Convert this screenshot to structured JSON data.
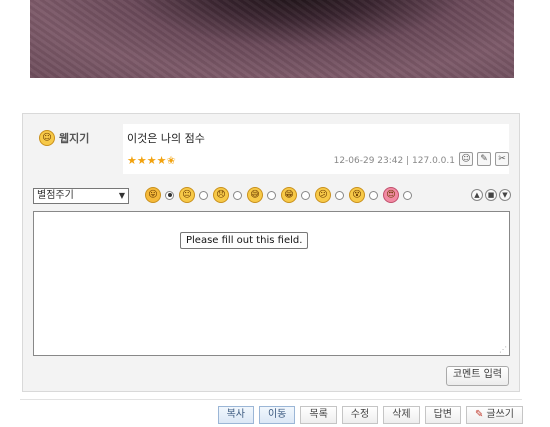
{
  "comment": {
    "author": "웹지기",
    "text": "이것은 나의 점수",
    "rating": 4.5,
    "date": "12-06-29 23:42",
    "ip": "127.0.0.1",
    "separator": "|"
  },
  "toolbar": {
    "score_select": "별점주기",
    "emoticons": [
      "tongue",
      "neutral",
      "sad",
      "sweat",
      "grin",
      "confused",
      "dizzy",
      "love"
    ],
    "selected_emoticon_index": 0
  },
  "textarea": {
    "value": "",
    "validation_message": "Please fill out this field."
  },
  "submit_label": "코멘트 입력",
  "buttons": {
    "copy": "복사",
    "move": "이동",
    "list": "목록",
    "edit": "수정",
    "delete": "삭제",
    "reply": "답변",
    "write": "글쓰기"
  },
  "colors": {
    "star": "#f2a20e",
    "blue_button": "#dce8f6"
  }
}
